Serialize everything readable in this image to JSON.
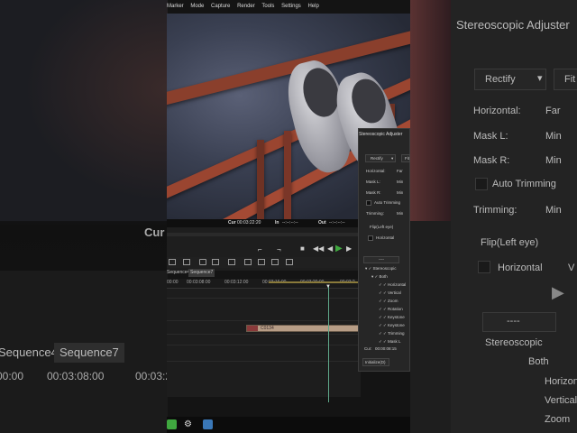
{
  "menu": [
    "Marker",
    "Mode",
    "Capture",
    "Render",
    "Tools",
    "Settings",
    "Help"
  ],
  "viewer": {
    "cur_label": "Cur",
    "cur_value": "00:03:22:20",
    "in_label": "In",
    "in_value": "--:--:--:--",
    "out_label": "Out",
    "out_value": "--:--:--:--"
  },
  "timeline": {
    "tabs": [
      "Sequence4",
      "Sequence7"
    ],
    "active_tab": "Sequence7",
    "ruler": [
      "00:00",
      "00:03:08:00",
      "00:03:12:00",
      "00:03:16:00",
      "00:03:20:00",
      "00:03:2"
    ],
    "clip_label": "C0134"
  },
  "adjuster": {
    "title": "Stereoscopic Adjuster",
    "mode": "Rectify",
    "mode2": "Fit",
    "fields": [
      {
        "label": "Horizontal:",
        "value": "Far"
      },
      {
        "label": "Mask L:",
        "value": "Min"
      },
      {
        "label": "Mask R:",
        "value": "Min"
      }
    ],
    "auto_trimming": "Auto Trimming",
    "trimming_label": "Trimming:",
    "trimming_value": "Min",
    "flip_label": "Flip(Left eye)",
    "horizontal_label": "Horizontal",
    "vertical_short": "V",
    "dash": "----",
    "tree": [
      "Stereoscopic",
      "Both",
      "Horizontal",
      "Vertical",
      "Zoom",
      "Rotation",
      "Keystone",
      "Keystone",
      "Trimming",
      "Mask L"
    ],
    "cur_label": "Cur:",
    "cur_value": "00:00:08:15",
    "initialize": "Initialize(D)"
  },
  "big_view": {
    "cur": "Cur",
    "tabs": [
      "Sequence4",
      "Sequence7"
    ],
    "ruler": [
      "00:00",
      "00:03:08:00",
      "00:03:2"
    ],
    "timecode_tail": "--:--:--"
  },
  "colors": {
    "accent": "#5fa88a",
    "clip": "#b79d86",
    "panel": "#262626"
  }
}
